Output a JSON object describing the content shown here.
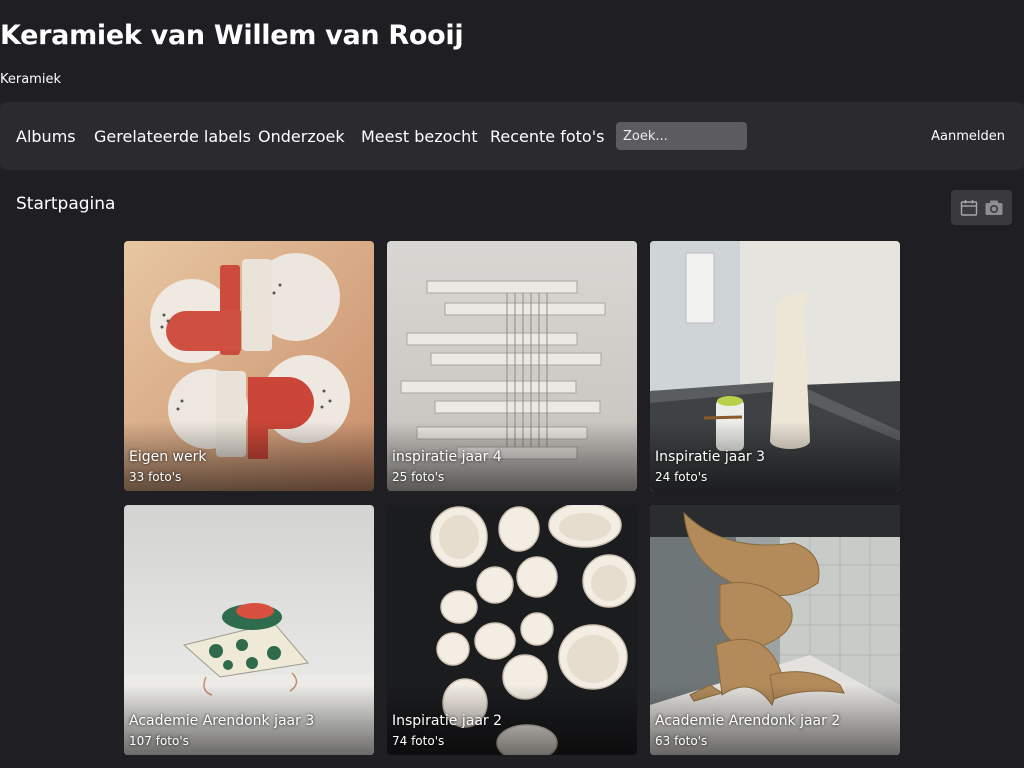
{
  "site": {
    "title": "Keramiek van Willem van Rooij",
    "subtitle": "Keramiek"
  },
  "nav": {
    "items": [
      {
        "label": "Albums"
      },
      {
        "label": "Gerelateerde labels"
      },
      {
        "label": "Onderzoek"
      },
      {
        "label": "Meest bezocht"
      },
      {
        "label": "Recente foto's"
      }
    ],
    "search_placeholder": "Zoek...",
    "search_value": "",
    "login_label": "Aanmelden"
  },
  "breadcrumb": "Startpagina",
  "view_toggle": {
    "buttons": [
      {
        "icon": "calendar-icon"
      },
      {
        "icon": "camera-icon"
      }
    ]
  },
  "albums": [
    {
      "name": "Eigen werk",
      "count": "33 foto's"
    },
    {
      "name": "inspiratie jaar 4",
      "count": "25 foto's"
    },
    {
      "name": "Inspiratie jaar 3",
      "count": "24 foto's"
    },
    {
      "name": "Academie Arendonk jaar 3",
      "count": "107 foto's"
    },
    {
      "name": "Inspiratie jaar 2",
      "count": "74 foto's"
    },
    {
      "name": "Academie Arendonk jaar 2",
      "count": "63 foto's"
    }
  ],
  "colors": {
    "background": "#1f1f23",
    "navbar": "#2b2b2f",
    "search_field": "#5b5b60",
    "toggle_group": "#3a3a3e",
    "text": "#ffffff"
  }
}
